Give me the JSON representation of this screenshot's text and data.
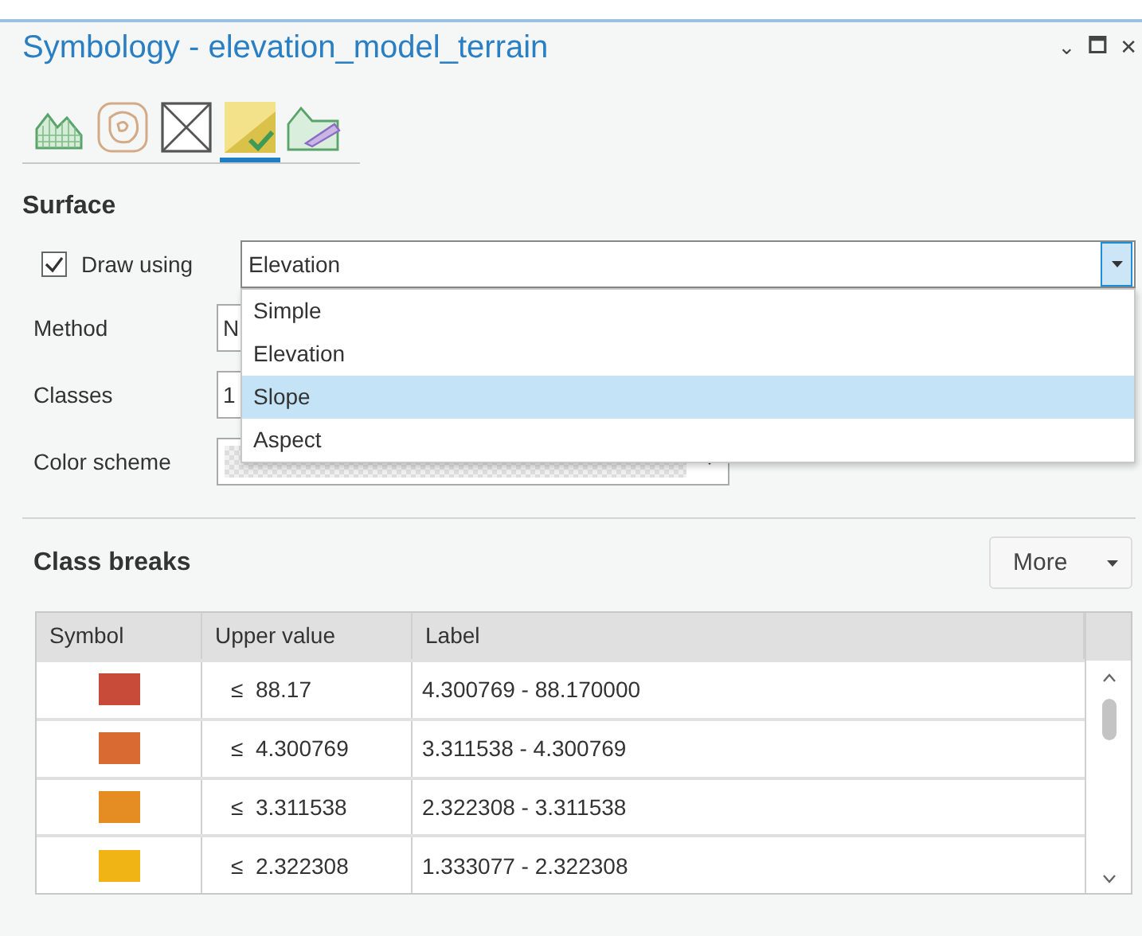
{
  "window": {
    "title": "Symbology - elevation_model_terrain",
    "controls": [
      "⌄",
      "🗖",
      "✕"
    ]
  },
  "tabs": [
    {
      "kind": "hillshade",
      "selected": false
    },
    {
      "kind": "contours",
      "selected": false
    },
    {
      "kind": "edges",
      "selected": false
    },
    {
      "kind": "surface",
      "selected": true
    },
    {
      "kind": "faces",
      "selected": false
    }
  ],
  "surface": {
    "heading": "Surface",
    "draw_using": {
      "label": "Draw using",
      "checked": true,
      "value": "Elevation",
      "expanded": true,
      "options": [
        {
          "label": "Simple",
          "highlighted": false
        },
        {
          "label": "Elevation",
          "highlighted": false
        },
        {
          "label": "Slope",
          "highlighted": true
        },
        {
          "label": "Aspect",
          "highlighted": false
        }
      ]
    },
    "method": {
      "label": "Method",
      "value": "N"
    },
    "classes": {
      "label": "Classes",
      "value": "1"
    },
    "color_scheme": {
      "label": "Color scheme"
    }
  },
  "class_breaks": {
    "heading": "Class breaks",
    "more_button": "More",
    "table": {
      "columns": [
        "Symbol",
        "Upper value",
        "Label"
      ],
      "rows": [
        {
          "color": "#c84b3a",
          "upper": "≤  88.17",
          "label": "4.300769 - 88.170000"
        },
        {
          "color": "#d86a32",
          "upper": "≤  4.300769",
          "label": "3.311538 - 4.300769"
        },
        {
          "color": "#e58d22",
          "upper": "≤  3.311538",
          "label": "2.322308 - 3.311538"
        },
        {
          "color": "#f0b515",
          "upper": "≤  2.322308",
          "label": "1.333077 - 2.322308"
        }
      ]
    }
  }
}
